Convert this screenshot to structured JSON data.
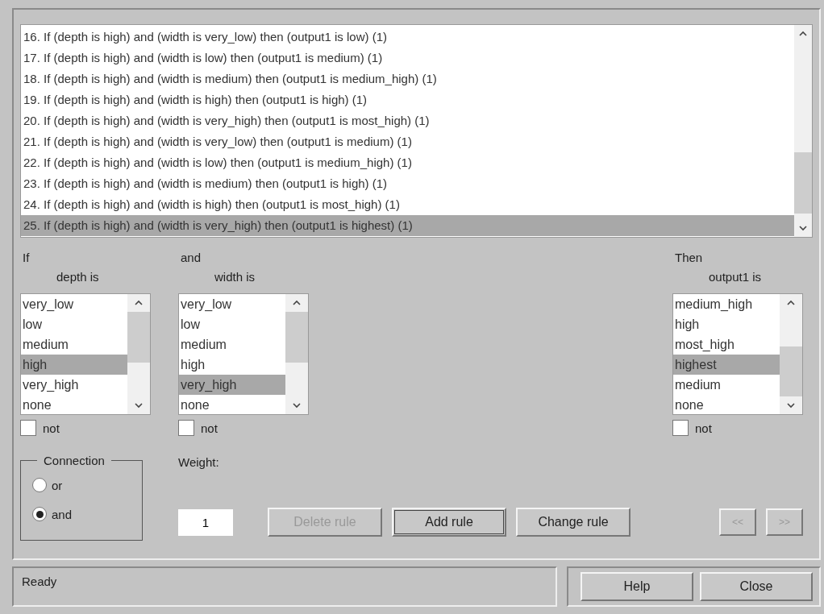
{
  "rules": [
    {
      "text": "16. If (depth is high) and (width is very_low) then (output1 is low) (1)",
      "selected": false
    },
    {
      "text": "17. If (depth is high) and (width is low) then (output1 is medium) (1)",
      "selected": false
    },
    {
      "text": "18. If (depth is high) and (width is medium) then (output1 is medium_high) (1)",
      "selected": false
    },
    {
      "text": "19. If (depth is high) and (width is high) then (output1 is high) (1)",
      "selected": false
    },
    {
      "text": "20. If (depth is high) and (width is very_high) then (output1 is most_high) (1)",
      "selected": false
    },
    {
      "text": "21. If (depth is high) and (width is very_low) then (output1 is medium) (1)",
      "selected": false
    },
    {
      "text": "22. If (depth is high) and (width is low) then (output1 is medium_high) (1)",
      "selected": false
    },
    {
      "text": "23. If (depth is high) and (width is medium) then (output1 is high) (1)",
      "selected": false
    },
    {
      "text": "24. If (depth is high) and (width is high) then (output1 is most_high) (1)",
      "selected": false
    },
    {
      "text": "25. If (depth is high) and (width is very_high) then (output1 is highest) (1)",
      "selected": true
    }
  ],
  "variables": [
    {
      "heading": "If",
      "label": "depth is",
      "not_label": "not",
      "not_checked": false,
      "options": [
        {
          "text": "very_low",
          "selected": false
        },
        {
          "text": "low",
          "selected": false
        },
        {
          "text": "medium",
          "selected": false
        },
        {
          "text": "high",
          "selected": true
        },
        {
          "text": "very_high",
          "selected": false
        },
        {
          "text": "none",
          "selected": false
        }
      ]
    },
    {
      "heading": "and",
      "label": "width is",
      "not_label": "not",
      "not_checked": false,
      "options": [
        {
          "text": "very_low",
          "selected": false
        },
        {
          "text": "low",
          "selected": false
        },
        {
          "text": "medium",
          "selected": false
        },
        {
          "text": "high",
          "selected": false
        },
        {
          "text": "very_high",
          "selected": true
        },
        {
          "text": "none",
          "selected": false
        }
      ]
    },
    {
      "heading": "Then",
      "label": "output1 is",
      "not_label": "not",
      "not_checked": false,
      "options": [
        {
          "text": "medium_high",
          "selected": false
        },
        {
          "text": "high",
          "selected": false
        },
        {
          "text": "most_high",
          "selected": false
        },
        {
          "text": "highest",
          "selected": true
        },
        {
          "text": "medium",
          "selected": false
        },
        {
          "text": "none",
          "selected": false
        }
      ]
    }
  ],
  "connection": {
    "title": "Connection",
    "options": [
      {
        "label": "or",
        "selected": false
      },
      {
        "label": "and",
        "selected": true
      }
    ]
  },
  "weight": {
    "label": "Weight:",
    "value": "1"
  },
  "rule_buttons": [
    {
      "label": "Delete rule",
      "disabled": true,
      "focused": false
    },
    {
      "label": "Add rule",
      "disabled": false,
      "focused": true
    },
    {
      "label": "Change rule",
      "disabled": false,
      "focused": false
    }
  ],
  "nav_buttons": [
    {
      "label": "<<",
      "disabled": true
    },
    {
      "label": ">>",
      "disabled": true
    }
  ],
  "status": "Ready",
  "footer_buttons": [
    {
      "label": "Help"
    },
    {
      "label": "Close"
    }
  ]
}
